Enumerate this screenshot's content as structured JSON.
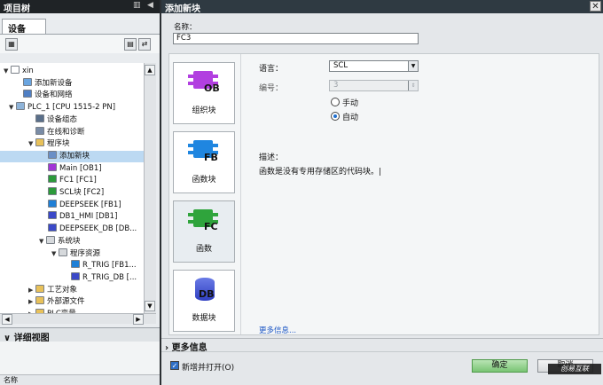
{
  "project_tree": {
    "title": "项目树",
    "tab": "设备",
    "items": [
      {
        "label": "xin",
        "toggle": "▼",
        "color": "#ffffff"
      },
      {
        "label": "添加新设备",
        "toggle": "",
        "color": "#6aa5e0"
      },
      {
        "label": "设备和网络",
        "toggle": "",
        "color": "#4f7fc4"
      },
      {
        "label": "PLC_1 [CPU 1515-2 PN]",
        "toggle": "▼",
        "color": "#8fb4d9"
      },
      {
        "label": "设备组态",
        "toggle": "",
        "color": "#5a6f8a"
      },
      {
        "label": "在线和诊断",
        "toggle": "",
        "color": "#7a8ca6"
      },
      {
        "label": "程序块",
        "toggle": "▼",
        "color": "#e8c15a"
      },
      {
        "label": "添加新块",
        "toggle": "",
        "color": "#6a8fc6"
      },
      {
        "label": "Main [OB1]",
        "toggle": "",
        "color": "#a235d6"
      },
      {
        "label": "FC1 [FC1]",
        "toggle": "",
        "color": "#2c9a3a"
      },
      {
        "label": "SCL块 [FC2]",
        "toggle": "",
        "color": "#2c9a3a"
      },
      {
        "label": "DEEPSEEK [FB1]",
        "toggle": "",
        "color": "#1f7fd6"
      },
      {
        "label": "DB1_HMI [DB1]",
        "toggle": "",
        "color": "#3b49c8"
      },
      {
        "label": "DEEPSEEK_DB [DB...",
        "toggle": "",
        "color": "#3b49c8"
      },
      {
        "label": "系统块",
        "toggle": "▼",
        "color": "#d6d9dc"
      },
      {
        "label": "程序资源",
        "toggle": "▼",
        "color": "#d6d9dc"
      },
      {
        "label": "R_TRIG [FB1...",
        "toggle": "",
        "color": "#1f7fd6"
      },
      {
        "label": "R_TRIG_DB [...",
        "toggle": "",
        "color": "#3b49c8"
      },
      {
        "label": "工艺对象",
        "toggle": "▶",
        "color": "#e8c15a"
      },
      {
        "label": "外部源文件",
        "toggle": "▶",
        "color": "#e8c15a"
      },
      {
        "label": "PLC变量",
        "toggle": "▶",
        "color": "#e8c15a"
      }
    ],
    "detail_title": "详细视图",
    "detail_column": "名称"
  },
  "dialog": {
    "title": "添加新块",
    "name_label": "名称：",
    "name_value": "FC3",
    "blocks": [
      {
        "label": "组织块",
        "tag": "OB",
        "color": "#b23fe0"
      },
      {
        "label": "函数块",
        "tag": "FB",
        "color": "#1f86e0"
      },
      {
        "label": "函数",
        "tag": "FC",
        "color": "#2fa43c"
      },
      {
        "label": "数据块",
        "tag": "DB",
        "color": "#3b49c8"
      }
    ],
    "language_label": "语言：",
    "language_value": "SCL",
    "number_label": "编号：",
    "number_value": "3",
    "radio_manual": "手动",
    "radio_auto": "自动",
    "desc_label": "描述：",
    "desc_text": "函数是没有专用存储区的代码块。",
    "more_link": "更多信息...",
    "more_section": "更多信息",
    "open_checkbox": "新增并打开(O)",
    "ok": "确定",
    "cancel": "取消",
    "watermark": "创易互联"
  }
}
